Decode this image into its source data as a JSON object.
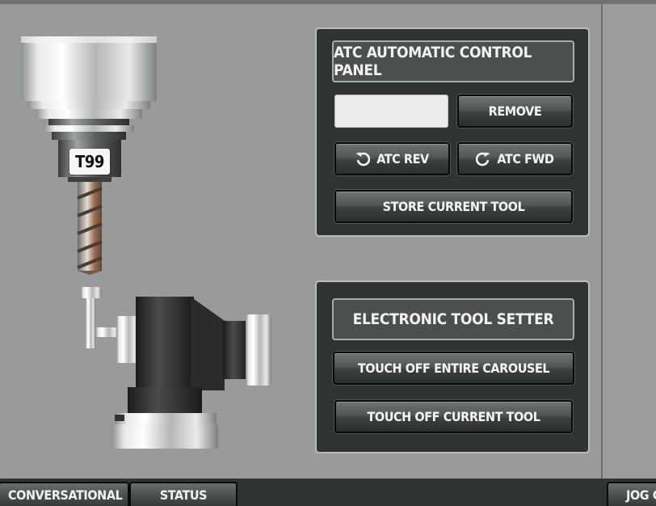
{
  "colors": {
    "background": "#999b9a",
    "panel": "#2e3333",
    "button_text": "#f4f4f4",
    "input_bg": "#ebebeb"
  },
  "illustration": {
    "tool_label": "T99",
    "spindle_icon": "spindle-with-endmill",
    "tool_setter_icon": "electronic-tool-setter"
  },
  "atc_panel": {
    "title": "ATC AUTOMATIC CONTROL PANEL",
    "tool_input_value": "",
    "remove_label": "REMOVE",
    "rev_label": "ATC REV",
    "rev_icon": "rotate-ccw-icon",
    "fwd_label": "ATC FWD",
    "fwd_icon": "rotate-cw-icon",
    "store_label": "STORE CURRENT TOOL"
  },
  "tool_setter_panel": {
    "title": "ELECTRONIC TOOL SETTER",
    "touch_carousel_label": "TOUCH OFF ENTIRE CAROUSEL",
    "touch_current_label": "TOUCH OFF CURRENT TOOL"
  },
  "bottom_tabs": [
    {
      "label": "CONVERSATIONAL"
    },
    {
      "label": "STATUS"
    },
    {
      "label": "JOG CONTROLS"
    }
  ]
}
